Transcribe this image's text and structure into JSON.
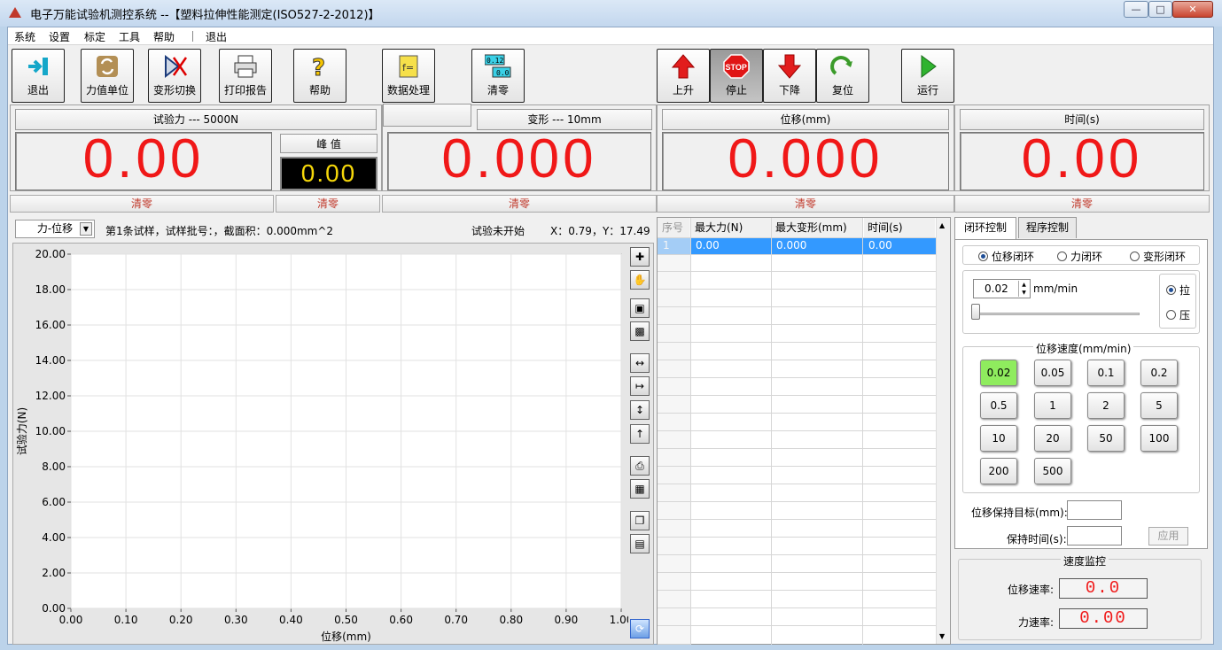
{
  "window": {
    "title": "电子万能试验机测控系统 --【塑料拉伸性能测定(ISO527-2-2012)】"
  },
  "menu": [
    "系统",
    "设置",
    "标定",
    "工具",
    "帮助",
    "退出"
  ],
  "toolbar": {
    "exit": "退出",
    "force_unit": "力值单位",
    "deform_switch": "变形切换",
    "print_report": "打印报告",
    "help": "帮助",
    "data_process": "数据处理",
    "clear": "清零",
    "clear_icon_value1": "0.12",
    "clear_icon_value2": "0.0",
    "up": "上升",
    "stop": "停止",
    "stop_icon_text": "STOP",
    "down": "下降",
    "reset": "复位",
    "run": "运行"
  },
  "panels": {
    "force": {
      "caption": "试验力 --- 5000N",
      "value": "0.00",
      "clear": "清零"
    },
    "peak": {
      "caption": "峰 值",
      "value": "0.00",
      "clear": "清零"
    },
    "deform": {
      "caption": "变形 --- 10mm",
      "value": "0.000",
      "clear": "清零"
    },
    "displacement": {
      "caption": "位移(mm)",
      "value": "0.000",
      "clear": "清零"
    },
    "time": {
      "caption": "时间(s)",
      "value": "0.00",
      "clear": "清零"
    }
  },
  "info": {
    "curve_type": "力-位移",
    "sample_info": "第1条试样，试样批号：，截面积：0.000mm^2",
    "status": "试验未开始",
    "cursor": "X：0.79，Y：17.49"
  },
  "chart_data": {
    "type": "line",
    "xlabel": "位移(mm)",
    "ylabel": "试验力(N)",
    "xlim": [
      0,
      1.0
    ],
    "ylim": [
      0,
      20.0
    ],
    "x_ticks": [
      "0.00",
      "0.10",
      "0.20",
      "0.30",
      "0.40",
      "0.50",
      "0.60",
      "0.70",
      "0.80",
      "0.90",
      "1.00"
    ],
    "y_ticks": [
      "0.00",
      "2.00",
      "4.00",
      "6.00",
      "8.00",
      "10.00",
      "12.00",
      "14.00",
      "16.00",
      "18.00",
      "20.00"
    ],
    "grid": true,
    "series": []
  },
  "table": {
    "headers": [
      "序号",
      "最大力(N)",
      "最大变形(mm)",
      "时间(s)"
    ],
    "rows": [
      [
        "1",
        "0.00",
        "0.000",
        "0.00"
      ]
    ]
  },
  "control": {
    "tabs": [
      "闭环控制",
      "程序控制"
    ],
    "modes": [
      "位移闭环",
      "力闭环",
      "变形闭环"
    ],
    "rate_value": "0.02",
    "rate_unit": "mm/min",
    "direction": [
      "拉",
      "压"
    ],
    "speed_title": "位移速度(mm/min)",
    "speeds": [
      "0.02",
      "0.05",
      "0.1",
      "0.2",
      "0.5",
      "1",
      "2",
      "5",
      "10",
      "20",
      "50",
      "100",
      "200",
      "500"
    ],
    "hold_target_label": "位移保持目标(mm):",
    "hold_time_label": "保持时间(s):",
    "apply": "应用"
  },
  "monitor": {
    "title": "速度监控",
    "disp_rate_label": "位移速率:",
    "disp_rate": "0.0",
    "force_rate_label": "力速率:",
    "force_rate": "0.00"
  }
}
